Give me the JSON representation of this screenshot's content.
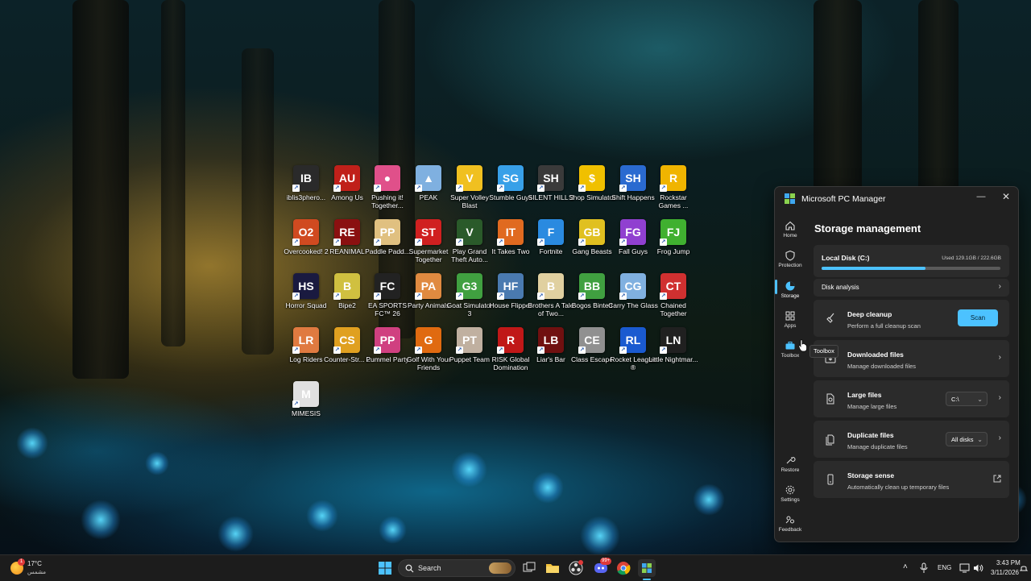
{
  "desktop": {
    "icons": [
      {
        "label": "iblis3phero...",
        "bg": "#2a2a2a",
        "glyph": "IB"
      },
      {
        "label": "Among Us",
        "bg": "#c0201a",
        "glyph": "AU"
      },
      {
        "label": "Pushing it! Together...",
        "bg": "#e0508a",
        "glyph": "●"
      },
      {
        "label": "PEAK",
        "bg": "#7fb0e0",
        "glyph": "▲"
      },
      {
        "label": "Super Volley Blast",
        "bg": "#f0c020",
        "glyph": "V"
      },
      {
        "label": "Stumble Guys",
        "bg": "#38a0e8",
        "glyph": "SG"
      },
      {
        "label": "SILENT HILL 2",
        "bg": "#3a3a3a",
        "glyph": "SH"
      },
      {
        "label": "Shop Simulator",
        "bg": "#f0c000",
        "glyph": "$"
      },
      {
        "label": "Shift Happens",
        "bg": "#2a6ad0",
        "glyph": "SH"
      },
      {
        "label": "Rockstar Games ...",
        "bg": "#f0b400",
        "glyph": "R"
      },
      {
        "label": "Overcooked! 2",
        "bg": "#d04a20",
        "glyph": "O2"
      },
      {
        "label": "REANIMAL",
        "bg": "#8a1010",
        "glyph": "RE"
      },
      {
        "label": "Paddle Padd...",
        "bg": "#e0c080",
        "glyph": "PP"
      },
      {
        "label": "Supermarket Together",
        "bg": "#d02020",
        "glyph": "ST"
      },
      {
        "label": "Play Grand Theft Auto...",
        "bg": "#2a5a2a",
        "glyph": "V"
      },
      {
        "label": "It Takes Two",
        "bg": "#e06a20",
        "glyph": "IT"
      },
      {
        "label": "Fortnite",
        "bg": "#2a8ae0",
        "glyph": "F"
      },
      {
        "label": "Gang Beasts",
        "bg": "#e0c020",
        "glyph": "GB"
      },
      {
        "label": "Fall Guys",
        "bg": "#9040d0",
        "glyph": "FG"
      },
      {
        "label": "Frog Jump",
        "bg": "#40b030",
        "glyph": "FJ"
      },
      {
        "label": "Horror Squad",
        "bg": "#1a1a40",
        "glyph": "HS"
      },
      {
        "label": "Bipe2",
        "bg": "#d0c040",
        "glyph": "B"
      },
      {
        "label": "EA SPORTS FC™ 26",
        "bg": "#222222",
        "glyph": "FC"
      },
      {
        "label": "Party Animals",
        "bg": "#e08a40",
        "glyph": "PA"
      },
      {
        "label": "Goat Simulator 3",
        "bg": "#40a040",
        "glyph": "G3"
      },
      {
        "label": "House Flipper",
        "bg": "#4a7ab0",
        "glyph": "HF"
      },
      {
        "label": "Brothers A Tale of Two...",
        "bg": "#e0d0a0",
        "glyph": "B"
      },
      {
        "label": "Bogos Binted",
        "bg": "#40a040",
        "glyph": "BB"
      },
      {
        "label": "Carry The Glass",
        "bg": "#80b0e0",
        "glyph": "CG"
      },
      {
        "label": "Chained Together",
        "bg": "#d03030",
        "glyph": "CT"
      },
      {
        "label": "Log Riders",
        "bg": "#e07a40",
        "glyph": "LR"
      },
      {
        "label": "Counter-Str... 2",
        "bg": "#e0a020",
        "glyph": "CS"
      },
      {
        "label": "Pummel Party",
        "bg": "#d04080",
        "glyph": "PP"
      },
      {
        "label": "Golf With Your Friends",
        "bg": "#e06a10",
        "glyph": "G"
      },
      {
        "label": "Puppet Team",
        "bg": "#c0b0a0",
        "glyph": "PT"
      },
      {
        "label": "RISK Global Domination",
        "bg": "#c01818",
        "glyph": "R"
      },
      {
        "label": "Liar's Bar",
        "bg": "#701010",
        "glyph": "LB"
      },
      {
        "label": "Class Escape",
        "bg": "#909090",
        "glyph": "CE"
      },
      {
        "label": "Rocket League ®",
        "bg": "#1a5ad0",
        "glyph": "RL"
      },
      {
        "label": "Little Nightmar...",
        "bg": "#202020",
        "glyph": "LN"
      },
      {
        "label": "MIMESIS",
        "bg": "#e0e0e0",
        "glyph": "M"
      }
    ]
  },
  "pc_manager": {
    "title": "Microsoft PC Manager",
    "nav": [
      {
        "label": "Home",
        "icon": "home-icon"
      },
      {
        "label": "Protection",
        "icon": "shield-icon"
      },
      {
        "label": "Storage",
        "icon": "pie-chart-icon"
      },
      {
        "label": "Apps",
        "icon": "grid-icon"
      },
      {
        "label": "Toolbox",
        "icon": "toolbox-icon"
      },
      {
        "label": "Restore",
        "icon": "wrench-icon"
      },
      {
        "label": "Settings",
        "icon": "gear-icon"
      },
      {
        "label": "Feedback",
        "icon": "feedback-icon"
      }
    ],
    "active_nav": "Storage",
    "heading": "Storage management",
    "disk": {
      "name": "Local Disk (C:)",
      "usage_text": "Used 129.1GB / 222.6GB",
      "used_fraction": 0.58
    },
    "disk_analysis_label": "Disk analysis",
    "deep_cleanup": {
      "title": "Deep cleanup",
      "subtitle": "Perform a full cleanup scan",
      "button": "Scan"
    },
    "downloaded": {
      "title": "Downloaded files",
      "subtitle": "Manage downloaded files"
    },
    "large": {
      "title": "Large files",
      "subtitle": "Manage large files",
      "dropdown": "C:\\"
    },
    "duplicate": {
      "title": "Duplicate files",
      "subtitle": "Manage duplicate files",
      "dropdown": "All disks"
    },
    "sense": {
      "title": "Storage sense",
      "subtitle": "Automatically clean up temporary files"
    },
    "tooltip": "Toolbox",
    "accent": "#4cc2ff"
  },
  "taskbar": {
    "weather_temp": "17°C",
    "weather_desc": "مشمس",
    "weather_badge": "1",
    "search_placeholder": "Search",
    "discord_badge": "99+",
    "language": "ENG",
    "time": "3:43 PM",
    "date": "3/11/2026"
  }
}
